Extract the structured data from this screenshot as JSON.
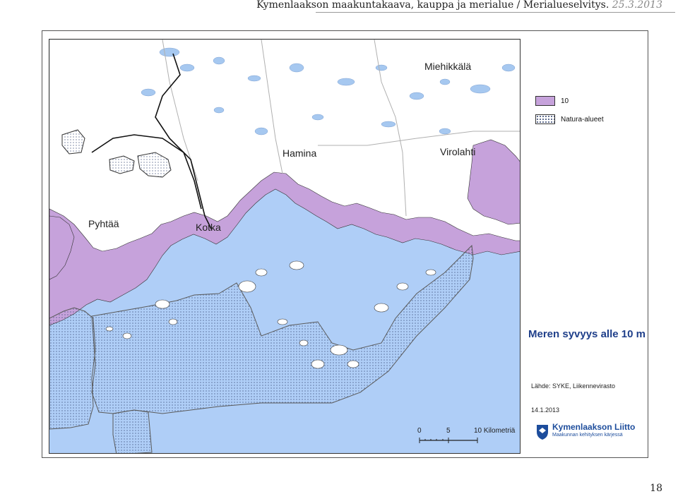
{
  "header": {
    "title": "Kymenlaakson maakuntakaava, kauppa ja merialue / Merialueselvitys.",
    "date": "25.3.2013"
  },
  "map": {
    "places": [
      "Miehikkälä",
      "Hamina",
      "Virolahti",
      "Pyhtää",
      "Kotka"
    ],
    "colors": {
      "sea": "#afcef7",
      "shallow_area": "#c6a2db",
      "land": "#ffffff",
      "lakes": "#a6c8f0"
    }
  },
  "legend": {
    "items": [
      {
        "label": "10",
        "color": "#c6a2db"
      },
      {
        "label": "Natura-alueet",
        "color": "#ffffff"
      }
    ]
  },
  "map_title": "Meren syvyys alle 10 m",
  "source": {
    "label": "Lähde:",
    "value": "SYKE, Liikennevirasto",
    "date": "14.1.2013"
  },
  "scale": {
    "ticks": [
      "0",
      "5",
      "10 Kilometriä"
    ]
  },
  "logo": {
    "name": "Kymenlaakson Liitto",
    "subtitle": "Maakunnan kehityksen kärjessä"
  },
  "page_number": "18"
}
